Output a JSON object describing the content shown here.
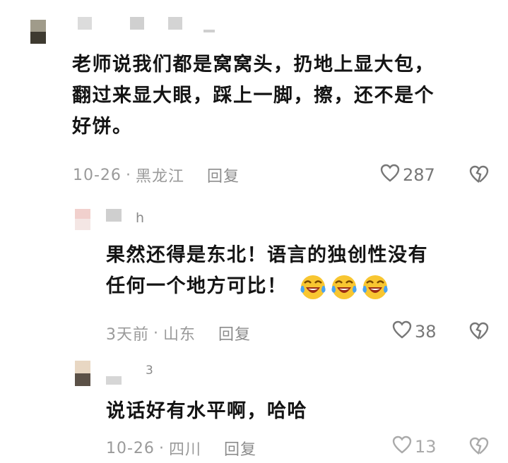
{
  "comments": [
    {
      "username_fragment": "",
      "text": "老师说我们都是窝窝头，扔地上显大包，翻过来显大眼，踩上一脚，擦，还不是个好饼。",
      "lines": [
        "老师说我们都是窝窝头，扔地上显大包，",
        "翻过来显大眼，踩上一脚，擦，还不是个",
        "好饼。"
      ],
      "date": "10-26",
      "location": "黑龙江",
      "reply_label": "回复",
      "likes": "287",
      "avatar_colors": [
        "#a09b8a",
        "#3e3a30"
      ]
    },
    {
      "username_fragment": "h",
      "text": "果然还得是东北！语言的独创性没有任何一个地方可比！",
      "lines": [
        "果然还得是东北！语言的独创性没有",
        "任何一个地方可比！"
      ],
      "date": "3天前",
      "location": "山东",
      "reply_label": "回复",
      "likes": "38",
      "emoji_count": 3,
      "avatar_colors": [
        "#f1d0cd",
        "#f4e6e4"
      ]
    },
    {
      "username_fragment": "3",
      "text": "说话好有水平啊，哈哈",
      "lines": [
        "说话好有水平啊，哈哈"
      ],
      "date": "10-26",
      "location": "四川",
      "reply_label": "回复",
      "likes": "13",
      "avatar_colors": [
        "#e8d7c3",
        "#5b5147"
      ]
    }
  ],
  "icons": {
    "like": "heart-outline-icon",
    "dislike": "broken-heart-icon",
    "emoji": "laughing-crying-emoji"
  }
}
